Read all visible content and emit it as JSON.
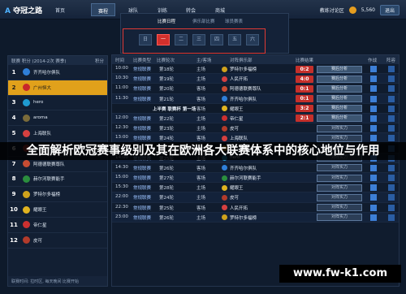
{
  "header": {
    "logo": "夺冠之路",
    "tabs": [
      "首页",
      "赛程",
      "球队",
      "训练",
      "转会",
      "商城"
    ],
    "active_tab": 1,
    "user": "教练讨论区",
    "coins": "5,560",
    "btn": "退出"
  },
  "date_selector": {
    "tabs": [
      "比赛日程",
      "俱乐部比赛",
      "球员赛表"
    ],
    "days": [
      "日",
      "一",
      "二",
      "三",
      "四",
      "五",
      "六"
    ],
    "active_day": 1
  },
  "left_panel": {
    "header_left": "联赛 积分 (2014-2次 赛季)",
    "header_right": "积分",
    "teams": [
      {
        "rank": "1",
        "name": "齐齐哈尔俱队",
        "color": "#2f7fd8"
      },
      {
        "rank": "2",
        "name": "广州恒大",
        "color": "#c8262a"
      },
      {
        "rank": "3",
        "name": "hero",
        "color": "#1f9bd1"
      },
      {
        "rank": "4",
        "name": "aroma",
        "color": "#7a6b3a"
      },
      {
        "rank": "5",
        "name": "上海联队",
        "color": "#d54040"
      },
      {
        "rank": "6",
        "name": "明星联赛",
        "color": "#ad3535"
      },
      {
        "rank": "7",
        "name": "阿德德联赛尊队",
        "color": "#c64c33"
      },
      {
        "rank": "8",
        "name": "赫尔河联赛能手",
        "color": "#2b8e3e"
      },
      {
        "rank": "9",
        "name": "罗特尔多福榜",
        "color": "#cfa21c"
      },
      {
        "rank": "10",
        "name": "耀眼王",
        "color": "#e0b320"
      },
      {
        "rank": "11",
        "name": "帝仁星",
        "color": "#cc3030"
      },
      {
        "rank": "12",
        "name": "皮可",
        "color": "#b23b2b"
      }
    ],
    "highlight_index": 1,
    "footer": "联赛时间: 拉时区, 每天晚间 比赛开始"
  },
  "grid": {
    "headers": [
      "时间",
      "比赛类型",
      "比赛轮次",
      "主/客场",
      "对阵俱乐部",
      "比赛结果",
      "作战",
      "阵容"
    ],
    "rows": [
      {
        "type": "match",
        "time": "10:00",
        "league": "常规联赛",
        "round": "第18轮",
        "side": "主场",
        "team": "罗特尔多福榜",
        "color": "#cfa21c",
        "score": "0:2",
        "btn": "赛后分析"
      },
      {
        "type": "match",
        "time": "10:30",
        "league": "常规联赛",
        "round": "第19轮",
        "side": "主场",
        "team": "人民开拓",
        "color": "#d54040",
        "score": "4:0",
        "btn": "赛后分析"
      },
      {
        "type": "match",
        "time": "11:00",
        "league": "常规联赛",
        "round": "第20轮",
        "side": "客场",
        "team": "阿德德联赛尊队",
        "color": "#c64c33",
        "score": "0:1",
        "btn": "赛后分析"
      },
      {
        "type": "match",
        "time": "11:30",
        "league": "常规联赛",
        "round": "第21轮",
        "side": "客场",
        "team": "齐齐哈尔俱队",
        "color": "#2f7fd8",
        "score": "0:1",
        "btn": "赛后分析"
      },
      {
        "type": "round",
        "time": "",
        "title": "上半赛 联赛杯 第一场",
        "side": "客场",
        "team": "耀眼王",
        "color": "#e0b320",
        "score": "3:2",
        "btn": "赛后分析"
      },
      {
        "type": "match",
        "time": "12:00",
        "league": "常规联赛",
        "round": "第22轮",
        "side": "主场",
        "team": "帝仁星",
        "color": "#cc3030",
        "score": "2:1",
        "btn": "赛后分析"
      },
      {
        "type": "match",
        "time": "12:30",
        "league": "常规联赛",
        "round": "第23轮",
        "side": "主场",
        "team": "皮可",
        "color": "#b23b2b",
        "score": "",
        "btn": "对阵实力"
      },
      {
        "type": "match",
        "time": "13:00",
        "league": "常规联赛",
        "round": "第24轮",
        "side": "客场",
        "team": "上海联队",
        "color": "#d54040",
        "score": "",
        "btn": "对阵实力"
      },
      {
        "type": "round",
        "time": "",
        "title": "上半赛 联赛杯 第二场",
        "side": "客场",
        "team": "罗特尔多福榜",
        "color": "#cfa21c",
        "score": "",
        "btn": "对阵实力"
      },
      {
        "type": "match",
        "time": "14:00",
        "league": "常规联赛",
        "round": "第25轮",
        "side": "主场",
        "team": "hero",
        "color": "#1f9bd1",
        "score": "",
        "btn": "对阵实力"
      },
      {
        "type": "match",
        "time": "14:30",
        "league": "常规联赛",
        "round": "第26轮",
        "side": "客场",
        "team": "齐齐哈尔俱队",
        "color": "#2f7fd8",
        "score": "",
        "btn": "对阵实力"
      },
      {
        "type": "match",
        "time": "15:00",
        "league": "常规联赛",
        "round": "第27轮",
        "side": "客场",
        "team": "赫尔河联赛能手",
        "color": "#2b8e3e",
        "score": "",
        "btn": "对阵实力"
      },
      {
        "type": "match",
        "time": "15:30",
        "league": "常规联赛",
        "round": "第28轮",
        "side": "主场",
        "team": "耀眼王",
        "color": "#e0b320",
        "score": "",
        "btn": "对阵实力"
      },
      {
        "type": "match",
        "time": "22:00",
        "league": "常规联赛",
        "round": "第24轮",
        "side": "主场",
        "team": "皮可",
        "color": "#b23b2b",
        "score": "",
        "btn": "对阵实力"
      },
      {
        "type": "match",
        "time": "22:30",
        "league": "常规联赛",
        "round": "第25轮",
        "side": "客场",
        "team": "人民开拓",
        "color": "#d54040",
        "score": "",
        "btn": "对阵实力"
      },
      {
        "type": "match",
        "time": "23:00",
        "league": "常规联赛",
        "round": "第26轮",
        "side": "主场",
        "team": "罗特尔多福榜",
        "color": "#cfa21c",
        "score": "",
        "btn": "对阵实力"
      }
    ]
  },
  "overlay": {
    "headline": "全面解析欧冠赛事级别及其在欧洲各大联赛体系中的核心地位与作用",
    "watermark": "www.fw-k1.com"
  }
}
